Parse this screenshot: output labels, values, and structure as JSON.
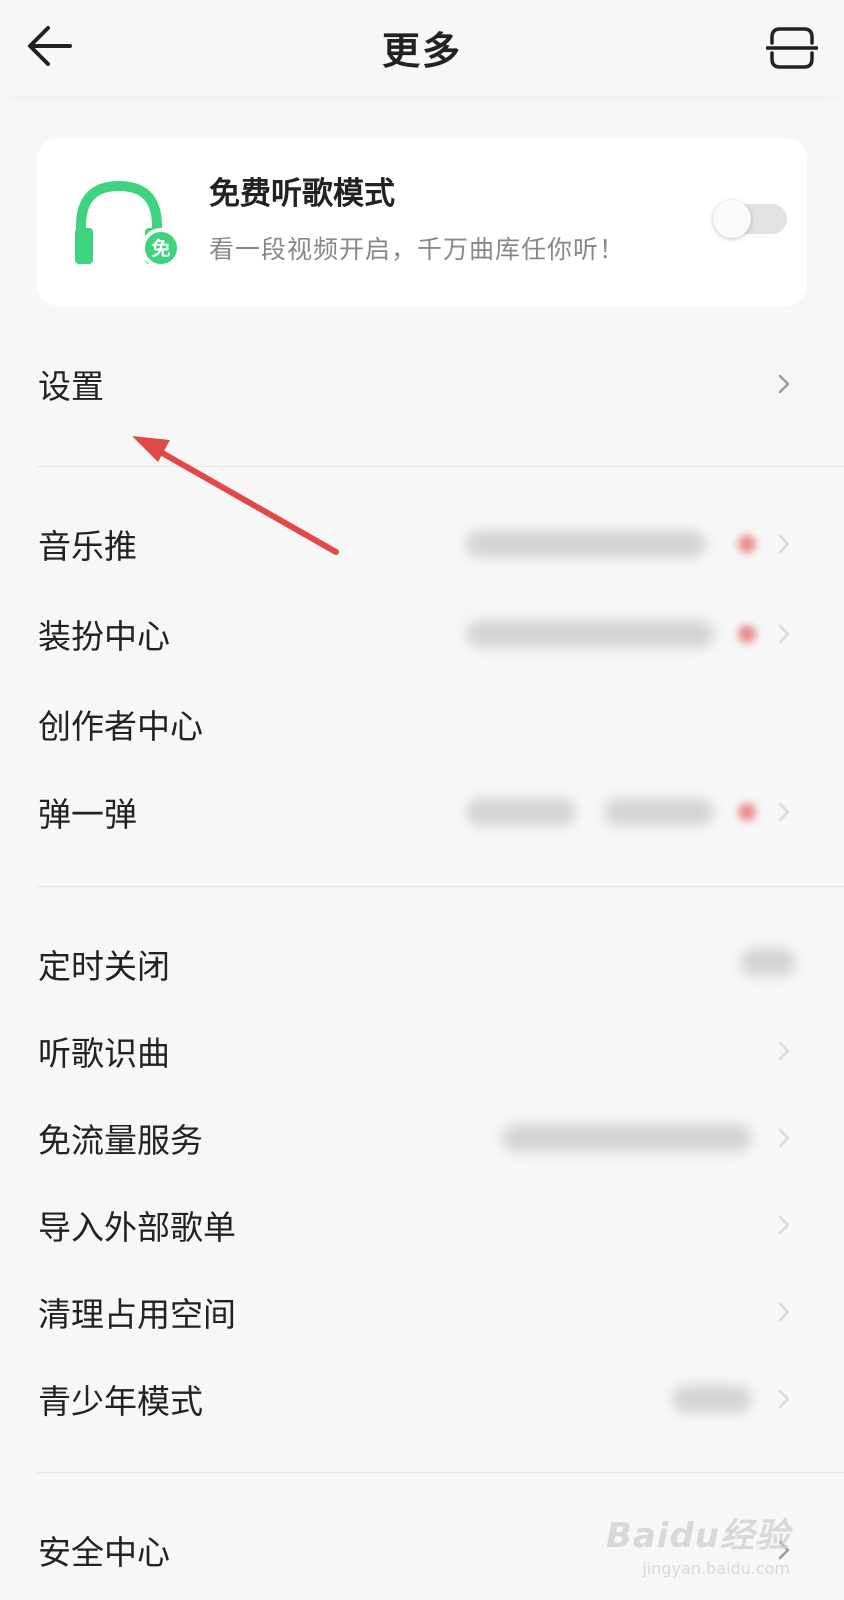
{
  "header": {
    "title": "更多",
    "back_icon": "arrow-left-icon",
    "scan_icon": "scan-icon"
  },
  "free_mode": {
    "title": "免费听歌模式",
    "description": "看一段视频开启，千万曲库任你听！",
    "badge_text": "免",
    "toggle_on": false,
    "accent_color": "#3fd37f"
  },
  "sections": [
    {
      "items": [
        {
          "label": "设置",
          "chevron": true
        }
      ]
    },
    {
      "items": [
        {
          "label": "音乐推",
          "chevron": true
        },
        {
          "label": "装扮中心",
          "chevron": true
        },
        {
          "label": "创作者中心",
          "chevron": false
        },
        {
          "label": "弹一弹",
          "chevron": true
        }
      ]
    },
    {
      "items": [
        {
          "label": "定时关闭",
          "chevron": false
        },
        {
          "label": "听歌识曲",
          "chevron": true
        },
        {
          "label": "免流量服务",
          "chevron": true
        },
        {
          "label": "导入外部歌单",
          "chevron": true
        },
        {
          "label": "清理占用空间",
          "chevron": true
        },
        {
          "label": "青少年模式",
          "chevron": true
        }
      ]
    },
    {
      "items": [
        {
          "label": "安全中心",
          "chevron": true
        }
      ]
    }
  ],
  "annotation": {
    "color": "#e04a46"
  },
  "watermark": {
    "brand": "Baidu经验",
    "url": "jingyan.baidu.com"
  }
}
